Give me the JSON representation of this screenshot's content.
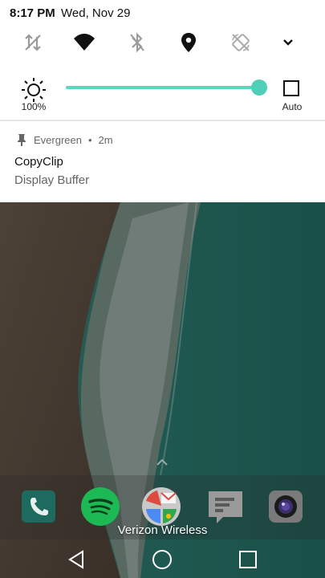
{
  "status_bar": {
    "time": "8:17 PM",
    "date": "Wed, Nov 29"
  },
  "quick_settings": {
    "toggles": [
      {
        "name": "data-transfer-icon",
        "state": "off"
      },
      {
        "name": "wifi-icon",
        "state": "on"
      },
      {
        "name": "bluetooth-icon",
        "state": "off"
      },
      {
        "name": "location-icon",
        "state": "on"
      },
      {
        "name": "auto-rotate-icon",
        "state": "off"
      },
      {
        "name": "chevron-down-icon",
        "state": "expand"
      }
    ],
    "brightness": {
      "label": "100%",
      "level": 1.0,
      "auto_label": "Auto",
      "auto_checked": false
    }
  },
  "notification": {
    "app_name": "Evergreen",
    "separator": "•",
    "time_ago": "2m",
    "title": "CopyClip",
    "text": "Display Buffer"
  },
  "home": {
    "carrier": "Verizon Wireless",
    "dock_apps": [
      "phone-app-icon",
      "spotify-app-icon",
      "google-apps-folder-icon",
      "messages-app-icon",
      "camera-app-icon"
    ]
  },
  "colors": {
    "accent": "#4fcfb8",
    "shade_bg": "#ffffff",
    "ocean": "#1f5a52",
    "sand": "#4a3f34"
  }
}
